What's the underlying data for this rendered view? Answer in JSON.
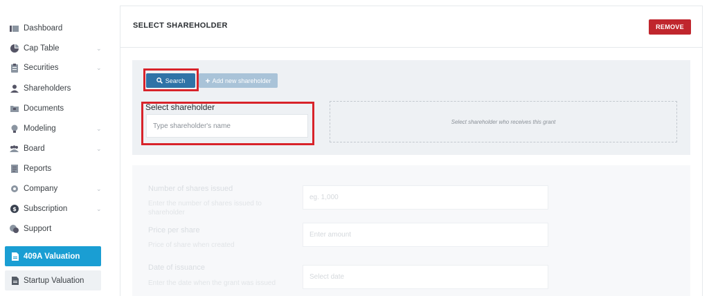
{
  "sidebar": {
    "items": [
      {
        "label": "Dashboard",
        "icon": "dashboard-icon",
        "has_submenu": false
      },
      {
        "label": "Cap Table",
        "icon": "pie-chart-icon",
        "has_submenu": true
      },
      {
        "label": "Securities",
        "icon": "clipboard-icon",
        "has_submenu": true
      },
      {
        "label": "Shareholders",
        "icon": "user-icon",
        "has_submenu": false
      },
      {
        "label": "Documents",
        "icon": "folder-icon",
        "has_submenu": false
      },
      {
        "label": "Modeling",
        "icon": "lightbulb-icon",
        "has_submenu": true
      },
      {
        "label": "Board",
        "icon": "group-icon",
        "has_submenu": true
      },
      {
        "label": "Reports",
        "icon": "document-icon",
        "has_submenu": false
      },
      {
        "label": "Company",
        "icon": "gear-icon",
        "has_submenu": true
      },
      {
        "label": "Subscription",
        "icon": "dollar-icon",
        "has_submenu": true
      },
      {
        "label": "Support",
        "icon": "chat-icon",
        "has_submenu": false
      }
    ],
    "valuation_buttons": [
      {
        "label": "409A Valuation",
        "icon": "file-icon"
      },
      {
        "label": "Startup Valuation",
        "icon": "file-icon"
      }
    ]
  },
  "panel": {
    "title": "SELECT SHAREHOLDER",
    "remove_label": "REMOVE",
    "search_label": "Search",
    "add_new_label": "Add new shareholder",
    "select_label": "Select shareholder",
    "select_placeholder": "Type shareholder's name",
    "drop_zone_text": "Select shareholder who receives this grant"
  },
  "form": {
    "fields": [
      {
        "label": "Number of shares issued",
        "help": "Enter the number of shares issued to shareholder",
        "placeholder": "eg. 1,000"
      },
      {
        "label": "Price per share",
        "help": "Price of share when created",
        "placeholder": "Enter amount"
      },
      {
        "label": "Date of issuance",
        "help": "Enter the date when the grant was issued",
        "placeholder": "Select date"
      }
    ]
  },
  "colors": {
    "accent_blue": "#1a9ed3",
    "search_blue": "#2f73a7",
    "remove_red": "#c0262d",
    "highlight_red": "#d8232a"
  }
}
